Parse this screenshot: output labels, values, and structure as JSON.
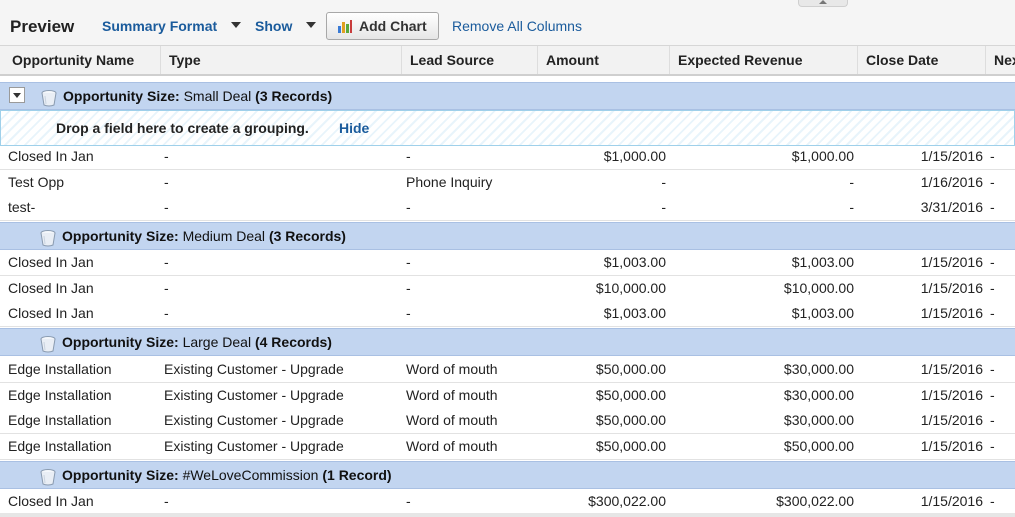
{
  "toolbar": {
    "title": "Preview",
    "summary_format_label": "Summary Format",
    "show_label": "Show",
    "add_chart_label": "Add Chart",
    "remove_all_columns_label": "Remove All Columns"
  },
  "columns": [
    "Opportunity Name",
    "Type",
    "Lead Source",
    "Amount",
    "Expected Revenue",
    "Close Date",
    "Nex"
  ],
  "group_field_label": "Opportunity Size:",
  "drop_zone": {
    "text": "Drop a field here to create a grouping.",
    "hide_label": "Hide"
  },
  "groups": [
    {
      "value": "Small Deal",
      "count_label": "(3 Records)",
      "rows": [
        [
          "Closed In Jan",
          "-",
          "-",
          "$1,000.00",
          "$1,000.00",
          "1/15/2016",
          "-"
        ],
        [
          "Test Opp",
          "-",
          "Phone Inquiry",
          "-",
          "-",
          "1/16/2016",
          "-"
        ],
        [
          "test-",
          "-",
          "-",
          "-",
          "-",
          "3/31/2016",
          "-"
        ]
      ]
    },
    {
      "value": "Medium Deal",
      "count_label": "(3 Records)",
      "rows": [
        [
          "Closed In Jan",
          "-",
          "-",
          "$1,003.00",
          "$1,003.00",
          "1/15/2016",
          "-"
        ],
        [
          "Closed In Jan",
          "-",
          "-",
          "$10,000.00",
          "$10,000.00",
          "1/15/2016",
          "-"
        ],
        [
          "Closed In Jan",
          "-",
          "-",
          "$1,003.00",
          "$1,003.00",
          "1/15/2016",
          "-"
        ]
      ]
    },
    {
      "value": "Large Deal",
      "count_label": "(4 Records)",
      "rows": [
        [
          "Edge Installation",
          "Existing Customer - Upgrade",
          "Word of mouth",
          "$50,000.00",
          "$30,000.00",
          "1/15/2016",
          "-"
        ],
        [
          "Edge Installation",
          "Existing Customer - Upgrade",
          "Word of mouth",
          "$50,000.00",
          "$30,000.00",
          "1/15/2016",
          "-"
        ],
        [
          "Edge Installation",
          "Existing Customer - Upgrade",
          "Word of mouth",
          "$50,000.00",
          "$30,000.00",
          "1/15/2016",
          "-"
        ],
        [
          "Edge Installation",
          "Existing Customer - Upgrade",
          "Word of mouth",
          "$50,000.00",
          "$50,000.00",
          "1/15/2016",
          "-"
        ]
      ]
    },
    {
      "value": "#WeLoveCommission",
      "count_label": "(1 Record)",
      "rows": [
        [
          "Closed In Jan",
          "-",
          "-",
          "$300,022.00",
          "$300,022.00",
          "1/15/2016",
          "-"
        ]
      ]
    }
  ],
  "icons": {
    "dropdown": "chevron-down-icon",
    "chart": "bar-chart-icon",
    "group": "bucket-icon",
    "toggle": "collapse-toggle-icon"
  },
  "colors": {
    "link": "#1a5b9c",
    "group_band": "#c2d5f0",
    "drop_zone_border": "#9fd0ea"
  }
}
